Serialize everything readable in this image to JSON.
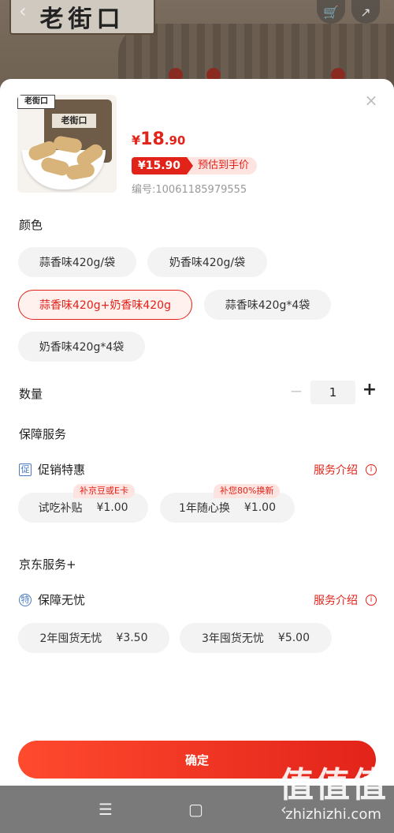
{
  "background": {
    "sign_text": "老街口",
    "back_icon": "chevron-left-icon",
    "cart_icon": "cart-icon",
    "share_icon": "share-icon"
  },
  "product": {
    "thumb_logo": "老街口",
    "price_symbol": "¥",
    "price_int": "18",
    "price_dec": ".90",
    "est_price": "¥15.90",
    "est_label": "预估到手价",
    "sku": "编号:10061185979555"
  },
  "color": {
    "title": "颜色",
    "options": [
      "蒜香味420g/袋",
      "奶香味420g/袋",
      "蒜香味420g+奶香味420g",
      "蒜香味420g*4袋",
      "奶香味420g*4袋"
    ],
    "selected": "蒜香味420g+奶香味420g"
  },
  "quantity": {
    "title": "数量",
    "minus": "−",
    "value": "1",
    "plus": "+"
  },
  "guarantee": {
    "title": "保障服务",
    "promo_icon": "促",
    "promo_label": "促销特惠",
    "intro_label": "服务介绍",
    "items": [
      {
        "name": "试吃补贴",
        "price": "¥1.00",
        "tag": "补京豆或E卡"
      },
      {
        "name": "1年随心换",
        "price": "¥1.00",
        "tag": "补您80%换新"
      }
    ]
  },
  "jd_service": {
    "title": "京东服务+",
    "icon": "特",
    "label": "保障无忧",
    "intro_label": "服务介绍",
    "items": [
      {
        "name": "2年囤货无忧",
        "price": "¥3.50"
      },
      {
        "name": "3年囤货无忧",
        "price": "¥5.00"
      }
    ]
  },
  "confirm_label": "确定",
  "watermark": {
    "big": "值值值",
    "small": "zhizhizhi.com"
  },
  "nav": {
    "menu": "☰",
    "home": "▢",
    "back": "‹"
  }
}
